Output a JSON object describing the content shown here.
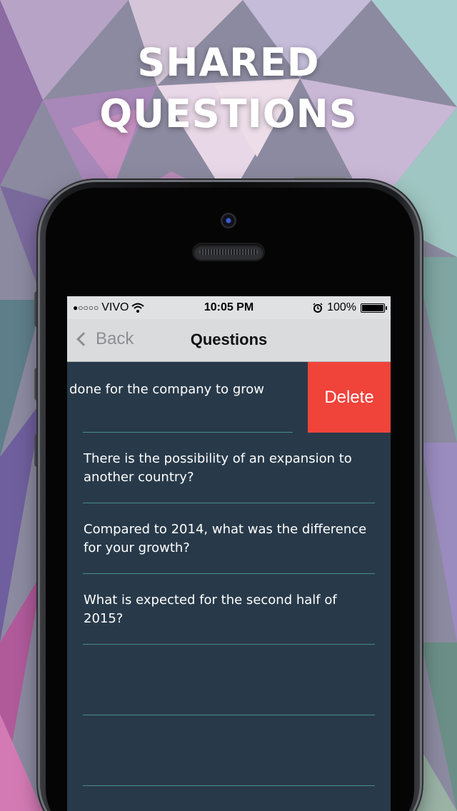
{
  "headline": {
    "line1": "SHARED",
    "line2": "QUESTIONS"
  },
  "status_bar": {
    "signal": "●○○○○",
    "carrier": "VIVO",
    "time": "10:05 PM",
    "battery_percent": "100%"
  },
  "nav": {
    "back_label": "Back",
    "title": "Questions"
  },
  "rows": [
    {
      "text": "done for the company to grow",
      "action": "Delete"
    },
    {
      "text": "There is the possibility of an expansion to another country?"
    },
    {
      "text": "Compared to 2014, what was the difference for your growth?"
    },
    {
      "text": "What is expected for the second half of 2015?"
    },
    {
      "text": ""
    },
    {
      "text": ""
    }
  ],
  "colors": {
    "list_background": "#283a4a",
    "separator": "#4a8b8b",
    "delete": "#f0433a",
    "nav_background": "#dadbdd"
  }
}
